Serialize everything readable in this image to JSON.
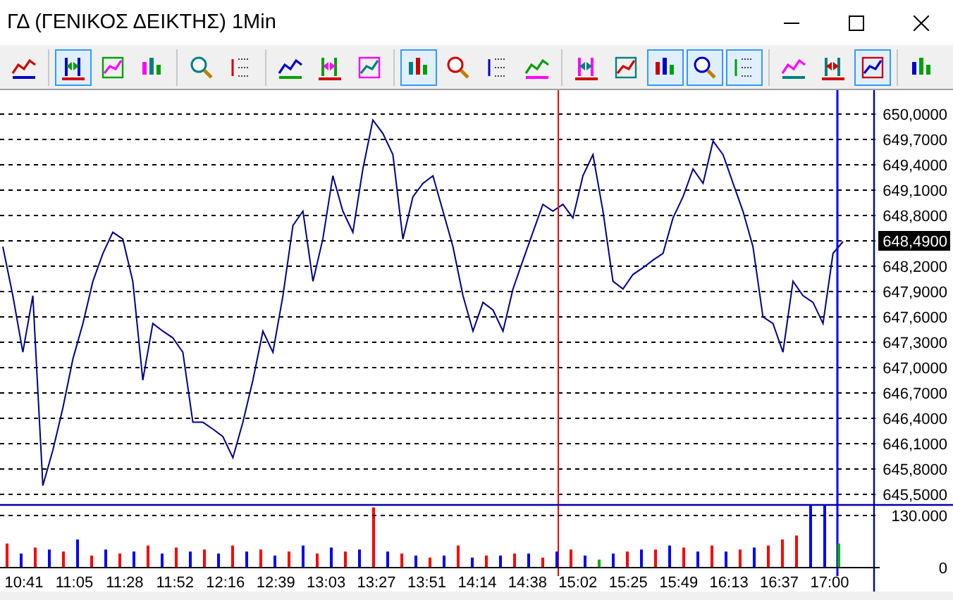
{
  "window": {
    "title": "ΓΔ (ΓΕΝΙΚΟΣ ΔΕΙΚΤΗΣ) 1Min"
  },
  "toolbar": [
    [
      {
        "selected": false
      }
    ],
    [
      {
        "selected": true
      },
      {
        "selected": false
      },
      {
        "selected": false
      }
    ],
    [
      {
        "selected": false
      },
      {
        "selected": false
      }
    ],
    [
      {
        "selected": false
      },
      {
        "selected": false
      },
      {
        "selected": false
      }
    ],
    [
      {
        "selected": true
      },
      {
        "selected": false
      },
      {
        "selected": false
      },
      {
        "selected": false
      }
    ],
    [
      {
        "selected": false
      },
      {
        "selected": false
      },
      {
        "selected": true
      },
      {
        "selected": true
      },
      {
        "selected": true
      }
    ],
    [
      {
        "selected": false
      },
      {
        "selected": false
      },
      {
        "selected": true
      }
    ],
    [
      {
        "selected": false
      }
    ]
  ],
  "price_axis": [
    {
      "text": "650,0000",
      "highlighted": false
    },
    {
      "text": "649,7000",
      "highlighted": false
    },
    {
      "text": "649,4000",
      "highlighted": false
    },
    {
      "text": "649,1000",
      "highlighted": false
    },
    {
      "text": "648,8000",
      "highlighted": false
    },
    {
      "text": "648,4900",
      "highlighted": true
    },
    {
      "text": "648,2000",
      "highlighted": false
    },
    {
      "text": "647,9000",
      "highlighted": false
    },
    {
      "text": "647,6000",
      "highlighted": false
    },
    {
      "text": "647,3000",
      "highlighted": false
    },
    {
      "text": "647,0000",
      "highlighted": false
    },
    {
      "text": "646,7000",
      "highlighted": false
    },
    {
      "text": "646,4000",
      "highlighted": false
    },
    {
      "text": "646,1000",
      "highlighted": false
    },
    {
      "text": "645,8000",
      "highlighted": false
    },
    {
      "text": "645,5000",
      "highlighted": false
    }
  ],
  "volume_axis": [
    "130.000",
    "0"
  ],
  "time_axis": [
    "10:41",
    "11:05",
    "11:28",
    "11:52",
    "12:16",
    "12:39",
    "13:03",
    "13:27",
    "13:51",
    "14:14",
    "14:38",
    "15:02",
    "15:25",
    "15:49",
    "16:13",
    "16:37",
    "17:00"
  ]
}
